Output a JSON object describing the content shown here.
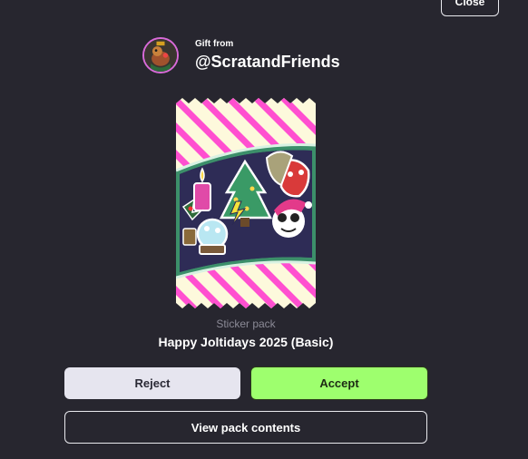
{
  "header": {
    "close_label": "Close"
  },
  "gift": {
    "from_label": "Gift from",
    "username": "@ScratandFriends"
  },
  "pack": {
    "type_label": "Sticker pack",
    "name": "Happy Joltidays 2025 (Basic)"
  },
  "actions": {
    "reject_label": "Reject",
    "accept_label": "Accept",
    "view_label": "View pack contents"
  },
  "colors": {
    "background": "#27262f",
    "accept": "#9eff6e",
    "reject": "#e6e5ef",
    "pack_stripe": "#ff4fd0",
    "pack_base": "#fdf9dc",
    "pack_band": "#3c8f6a"
  },
  "icons": [
    "avatar-image",
    "sticker-pack-image"
  ]
}
